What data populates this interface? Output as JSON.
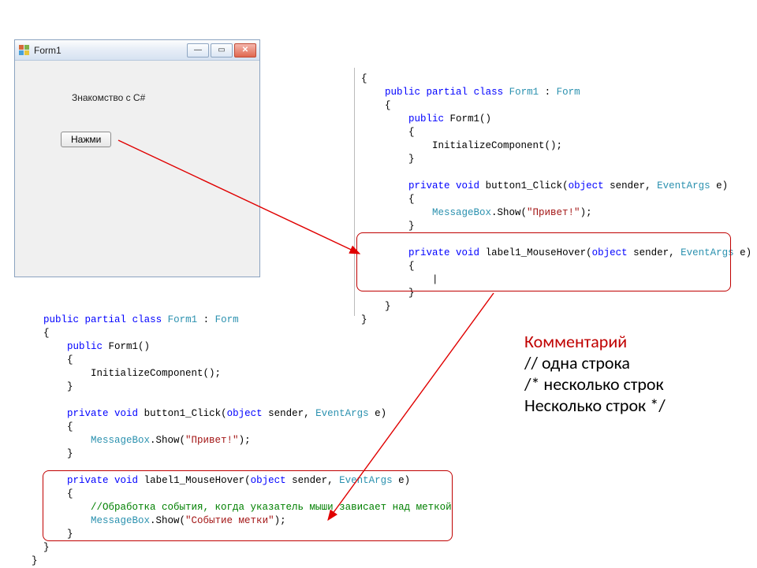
{
  "window": {
    "title": "Form1",
    "label_text": "Знакомство с C#",
    "button_text": "Нажми"
  },
  "code_top_right": {
    "l1_kw1": "public",
    "l1_kw2": "partial",
    "l1_kw3": "class",
    "l1_t1": "Form1",
    "l1_t2": "Form",
    "l3_kw1": "public",
    "l3_m": "Form1()",
    "l5": "InitializeComponent();",
    "l8_kw1": "private",
    "l8_kw2": "void",
    "l8_m": "button1_Click(",
    "l8_kw3": "object",
    "l8_p": " sender, ",
    "l8_t": "EventArgs",
    "l8_e": " e)",
    "l10_a": "MessageBox",
    "l10_b": ".Show(",
    "l10_s": "\"Привет!\"",
    "l10_c": ");",
    "l13_kw1": "private",
    "l13_kw2": "void",
    "l13_m": "label1_MouseHover(",
    "l13_kw3": "object",
    "l13_p": " sender, ",
    "l13_t": "EventArgs",
    "l13_e": " e)"
  },
  "code_bottom": {
    "l1_kw1": "public",
    "l1_kw2": "partial",
    "l1_kw3": "class",
    "l1_t1": "Form1",
    "l1_t2": "Form",
    "l3_kw1": "public",
    "l3_m": "Form1()",
    "l5": "InitializeComponent();",
    "l8_kw1": "private",
    "l8_kw2": "void",
    "l8_m": "button1_Click(",
    "l8_kw3": "object",
    "l8_p": " sender, ",
    "l8_t": "EventArgs",
    "l8_e": " e)",
    "l10_a": "MessageBox",
    "l10_b": ".Show(",
    "l10_s": "\"Привет!\"",
    "l10_c": ");",
    "l13_kw1": "private",
    "l13_kw2": "void",
    "l13_m": "label1_MouseHover(",
    "l13_kw3": "object",
    "l13_p": " sender, ",
    "l13_t": "EventArgs",
    "l13_e": " e)",
    "l15_cmt": "//Обработка события, когда указатель мыши зависает над меткой",
    "l16_a": "MessageBox",
    "l16_b": ".Show(",
    "l16_s": "\"Событие метки\"",
    "l16_c": ");"
  },
  "sidebar": {
    "header": "Комментарий",
    "line1": "// одна строка",
    "line2": "/* несколько строк",
    "line3": "Несколько строк */"
  }
}
